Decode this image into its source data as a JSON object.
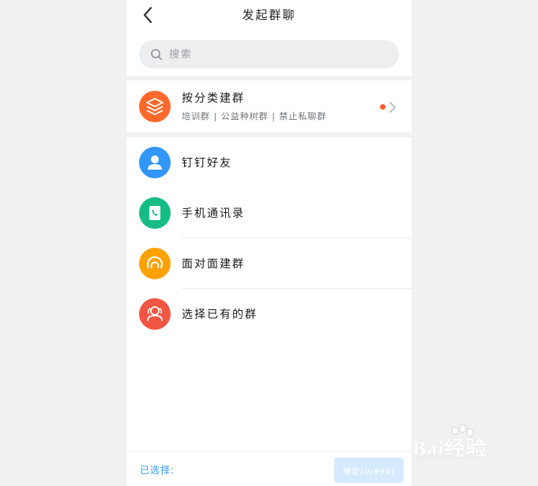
{
  "header": {
    "title": "发起群聊",
    "back_icon": "chevron-left-icon"
  },
  "search": {
    "placeholder": "搜索",
    "icon": "search-icon"
  },
  "category_group": {
    "title": "按分类建群",
    "subtitle": "培训群 | 公益种树群 | 禁止私聊群",
    "icon": "layers-icon",
    "color": "#ff6a2c",
    "has_new_dot": true
  },
  "options": [
    {
      "label": "钉钉好友",
      "icon": "user-icon",
      "color": "#3296fa"
    },
    {
      "label": "手机通讯录",
      "icon": "contacts-book-icon",
      "color": "#15bc83"
    },
    {
      "label": "面对面建群",
      "icon": "radar-icon",
      "color": "#ffa200"
    },
    {
      "label": "选择已有的群",
      "icon": "group-icon",
      "color": "#f25643"
    }
  ],
  "footer": {
    "selected_label": "已选择:",
    "confirm_label": "确定(0/999)"
  },
  "colors": {
    "accent": "#3296fa",
    "background": "#f1f1f2"
  },
  "watermark": {
    "text": "Bai经验",
    "url_text": "jingyan.baidu.com"
  }
}
